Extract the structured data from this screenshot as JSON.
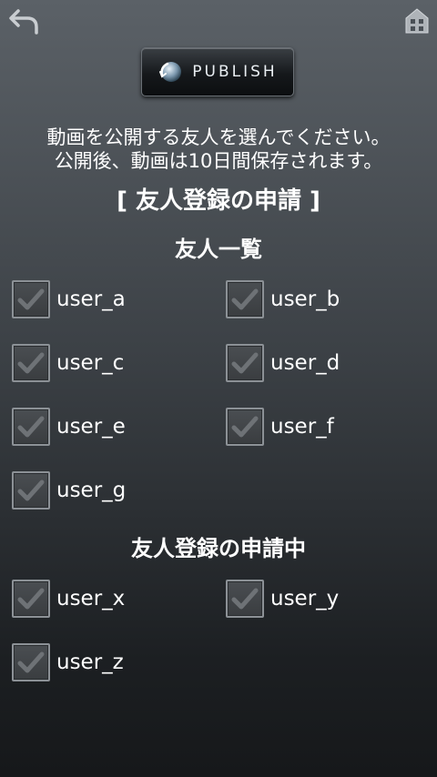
{
  "header": {
    "back_icon": "back-arrow-icon",
    "home_icon": "home-icon"
  },
  "publish_button": {
    "label": "PUBLISH",
    "icon": "globe-refresh-icon"
  },
  "description": {
    "line1": "動画を公開する友人を選んでください。",
    "line2": "公開後、動画は10日間保存されます。"
  },
  "friend_request_link": "[ 友人登録の申請 ]",
  "friends_section": {
    "title": "友人一覧",
    "users": [
      {
        "name": "user_a",
        "checked": true
      },
      {
        "name": "user_b",
        "checked": true
      },
      {
        "name": "user_c",
        "checked": true
      },
      {
        "name": "user_d",
        "checked": true
      },
      {
        "name": "user_e",
        "checked": true
      },
      {
        "name": "user_f",
        "checked": true
      },
      {
        "name": "user_g",
        "checked": true
      }
    ]
  },
  "pending_section": {
    "title": "友人登録の申請中",
    "users": [
      {
        "name": "user_x",
        "checked": true
      },
      {
        "name": "user_y",
        "checked": true
      },
      {
        "name": "user_z",
        "checked": true
      }
    ]
  },
  "colors": {
    "background_top": "#5b6167",
    "background_bottom": "#16181a",
    "check_mark": "#6e7276"
  }
}
